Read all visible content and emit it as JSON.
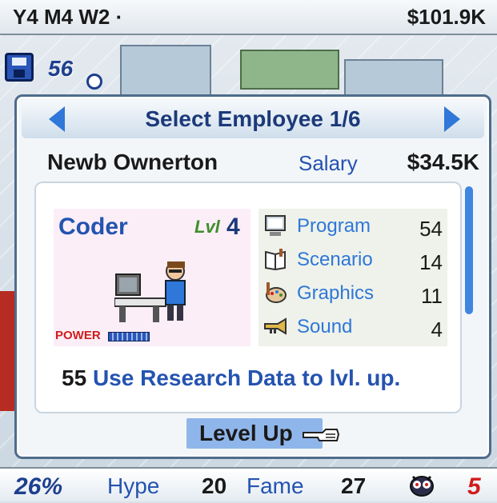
{
  "topbar": {
    "date": "Y4 M4 W2",
    "date_marker": "·",
    "money": "$101.9K"
  },
  "status": {
    "count": "56"
  },
  "dialog": {
    "title": "Select Employee 1/6",
    "employee_name": "Newb Ownerton",
    "salary_label": "Salary",
    "salary_value": "$34.5K",
    "role": "Coder",
    "level_label": "Lvl",
    "level_value": "4",
    "power_label": "POWER",
    "stats": [
      {
        "label": "Program",
        "value": "54",
        "icon": "computer-icon"
      },
      {
        "label": "Scenario",
        "value": "14",
        "icon": "book-icon"
      },
      {
        "label": "Graphics",
        "value": "11",
        "icon": "palette-icon"
      },
      {
        "label": "Sound",
        "value": "4",
        "icon": "trumpet-icon"
      }
    ],
    "research_cost": "55",
    "research_message": "Use Research Data to lvl. up.",
    "level_up_button": "Level Up"
  },
  "bottombar": {
    "percent": "26%",
    "hype_label": "Hype",
    "hype_value": "20",
    "fame_label": "Fame",
    "fame_value": "27",
    "fans_value": "5"
  },
  "colors": {
    "accent_blue": "#2453b0",
    "link_blue": "#2f77d8",
    "button_blue": "#8fb6ea",
    "power_red": "#d21c1c"
  }
}
